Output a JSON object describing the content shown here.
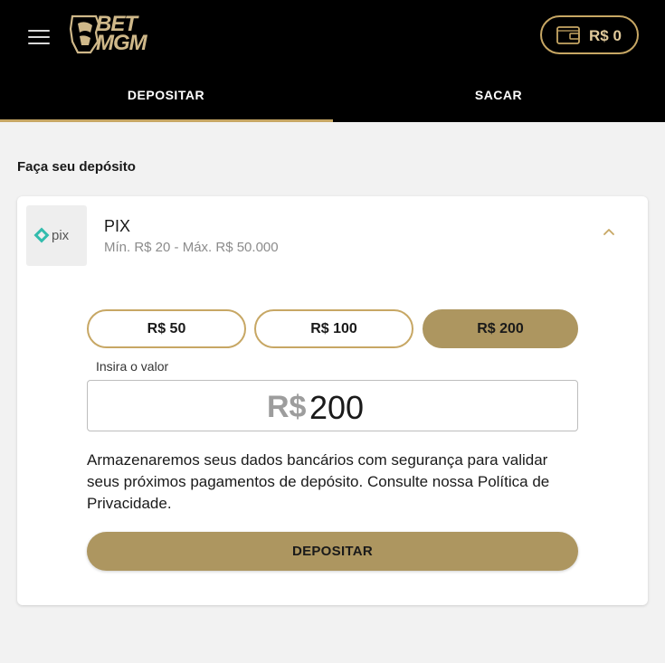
{
  "header": {
    "logo_line1": "BET",
    "logo_line2": "MGM",
    "balance": "R$ 0"
  },
  "tabs": [
    {
      "label": "DEPOSITAR",
      "active": true
    },
    {
      "label": "SACAR",
      "active": false
    }
  ],
  "section_title": "Faça seu depósito",
  "payment_method": {
    "name": "PIX",
    "limits": "Mín. R$ 20 - Máx. R$ 50.000",
    "logo_text": "pix"
  },
  "quick_amounts": [
    {
      "label": "R$ 50",
      "selected": false
    },
    {
      "label": "R$ 100",
      "selected": false
    },
    {
      "label": "R$ 200",
      "selected": true
    }
  ],
  "amount_input": {
    "label": "Insira o valor",
    "currency": "R$",
    "value": "200"
  },
  "notice": "Armazenaremos seus dados bancários com segurança para validar seus próximos pagamentos de depósito. Consulte nossa Política de Privacidade.",
  "submit_label": "DEPOSITAR",
  "colors": {
    "gold": "#c7a764",
    "gold_fill": "#ad9660",
    "header_bg": "#000000",
    "page_bg": "#f2f2f2",
    "pix_teal": "#32bcad"
  },
  "icons": {
    "menu": "hamburger-menu-icon",
    "wallet": "wallet-icon",
    "chevron": "chevron-up-icon"
  }
}
